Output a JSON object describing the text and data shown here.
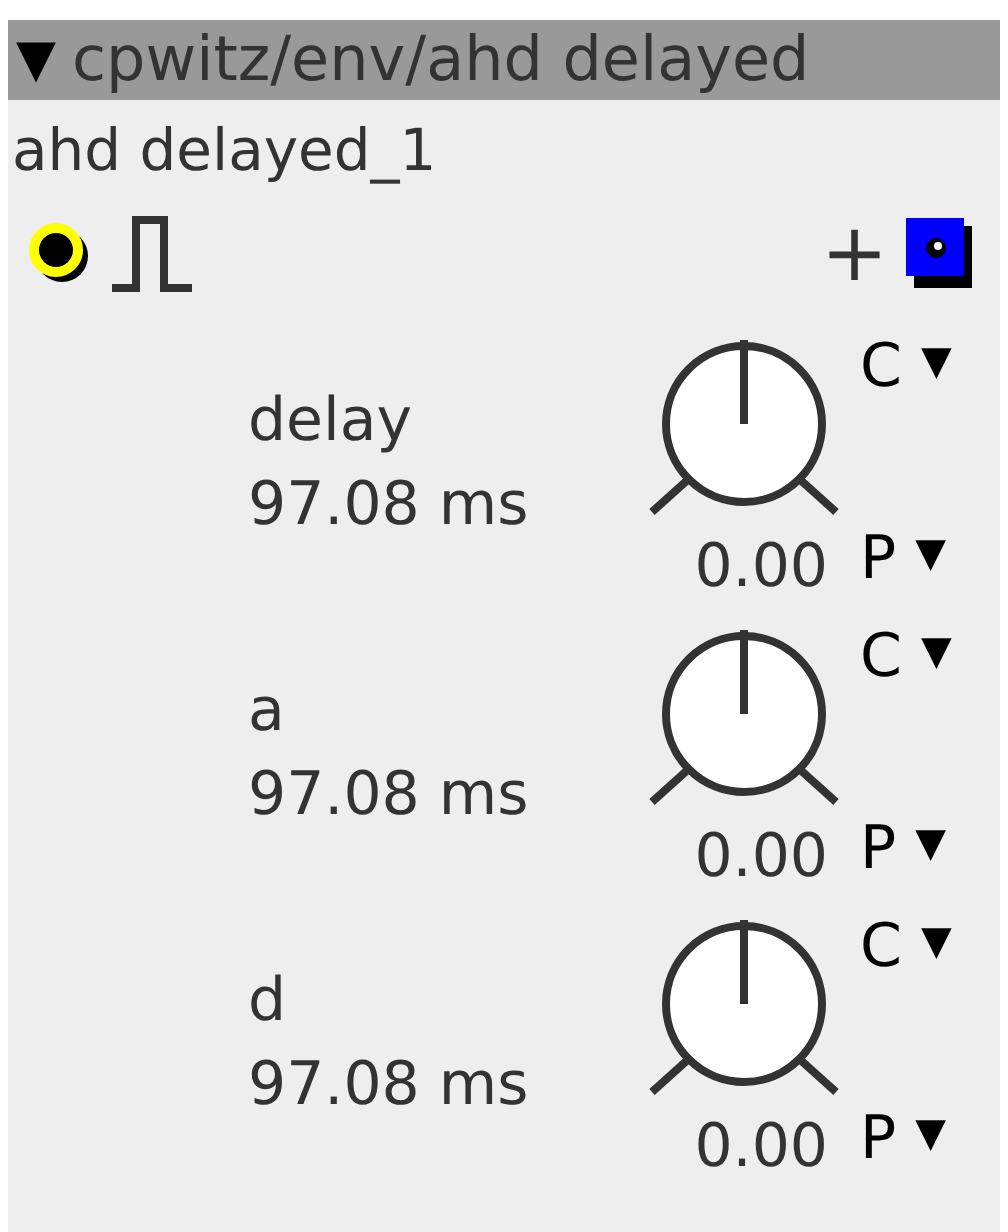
{
  "title_bar": {
    "toggle": "▼",
    "title": "cpwitz/env/ahd delayed",
    "expanded": true
  },
  "instance_name": "ahd delayed_1",
  "toolbar": {
    "add": "+"
  },
  "parameters": [
    {
      "name": "delay",
      "value": "97.08 ms",
      "knob_reading": "0.00",
      "c_label": "C",
      "c_caret": "▼",
      "p_label": "P",
      "p_caret": "▼"
    },
    {
      "name": "a",
      "value": "97.08 ms",
      "knob_reading": "0.00",
      "c_label": "C",
      "c_caret": "▼",
      "p_label": "P",
      "p_caret": "▼"
    },
    {
      "name": "d",
      "value": "97.08 ms",
      "knob_reading": "0.00",
      "c_label": "C",
      "c_caret": "▼",
      "p_label": "P",
      "p_caret": "▼"
    }
  ]
}
